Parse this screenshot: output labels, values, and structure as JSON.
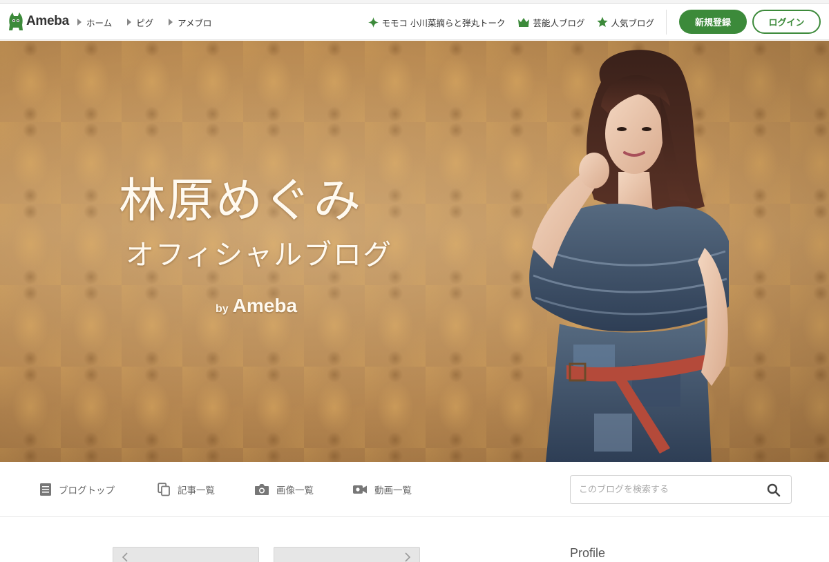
{
  "header": {
    "logo_text": "Ameba",
    "nav_left": [
      {
        "label": "ホーム"
      },
      {
        "label": "ピグ"
      },
      {
        "label": "アメブロ"
      }
    ],
    "nav_right": [
      {
        "label": "モモコ 小川菜摘らと弾丸トーク",
        "icon": "sparkle-icon"
      },
      {
        "label": "芸能人ブログ",
        "icon": "crown-icon"
      },
      {
        "label": "人気ブログ",
        "icon": "star-icon"
      }
    ],
    "register_label": "新規登録",
    "login_label": "ログイン"
  },
  "hero": {
    "title": "林原めぐみ",
    "subtitle": "オフィシャルブログ",
    "by": "by",
    "brand": "Ameba"
  },
  "subnav": {
    "items": [
      {
        "label": "ブログトップ",
        "icon": "document-icon"
      },
      {
        "label": "記事一覧",
        "icon": "copy-icon"
      },
      {
        "label": "画像一覧",
        "icon": "camera-icon"
      },
      {
        "label": "動画一覧",
        "icon": "video-icon"
      }
    ],
    "search_placeholder": "このブログを検索する"
  },
  "main": {
    "profile_heading": "Profile"
  },
  "colors": {
    "accent": "#3c8a3a",
    "hero_wallpaper": "#b8874e"
  }
}
